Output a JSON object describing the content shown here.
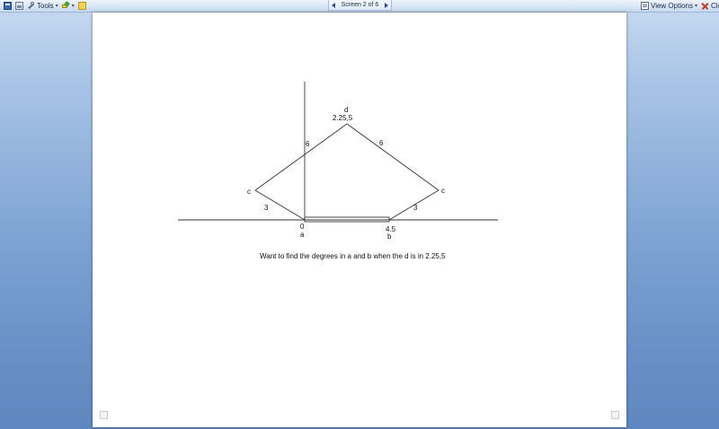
{
  "toolbar": {
    "tools_label": "Tools",
    "screen_label": "Screen 2 of 6",
    "view_options_label": "View Options",
    "close_label": "Close",
    "icons": [
      "save-icon",
      "print-icon",
      "tools-icon",
      "markup-icon",
      "note-icon",
      "prev-screen-icon",
      "next-screen-icon",
      "view-options-icon",
      "close-icon"
    ]
  },
  "diagram": {
    "point_d_label": "d",
    "point_d_coords": "2.25,5",
    "left_c_label": "c",
    "right_c_label": "c",
    "left_upper_side": "6",
    "right_upper_side": "6",
    "left_lower_side": "3",
    "right_lower_side": "3",
    "origin_value": "0",
    "point_a_label": "a",
    "point_b_value": "4.5",
    "point_b_label": "b",
    "caption": "Want to find the degrees in a and b when the d is in 2.25,5"
  }
}
